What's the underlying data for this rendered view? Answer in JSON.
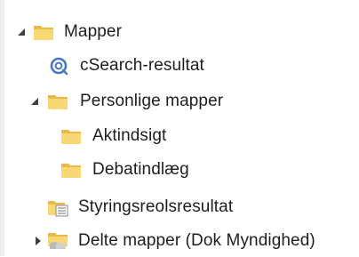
{
  "tree": {
    "items": [
      {
        "label": "Mapper",
        "icon": "folder-icon",
        "expanded": true,
        "caret": "expanded"
      },
      {
        "label": "cSearch-resultat",
        "icon": "search-result-icon",
        "caret": "none"
      },
      {
        "label": "Personlige mapper",
        "icon": "folder-icon",
        "expanded": true,
        "caret": "expanded"
      },
      {
        "label": "Aktindsigt",
        "icon": "folder-icon",
        "caret": "none"
      },
      {
        "label": "Debatindlæg",
        "icon": "folder-icon",
        "caret": "none"
      },
      {
        "label": "Styringsreolsresultat",
        "icon": "shelf-result-icon",
        "caret": "none"
      },
      {
        "label": "Delte mapper (Dok Myndighed)",
        "icon": "shared-folder-icon",
        "expanded": false,
        "caret": "collapsed"
      }
    ]
  },
  "colors": {
    "folder_body": "#f8d775",
    "folder_tab": "#e9b949",
    "search_ring": "#4a78c2",
    "caret": "#404040",
    "shelf": "#c9a24a"
  }
}
